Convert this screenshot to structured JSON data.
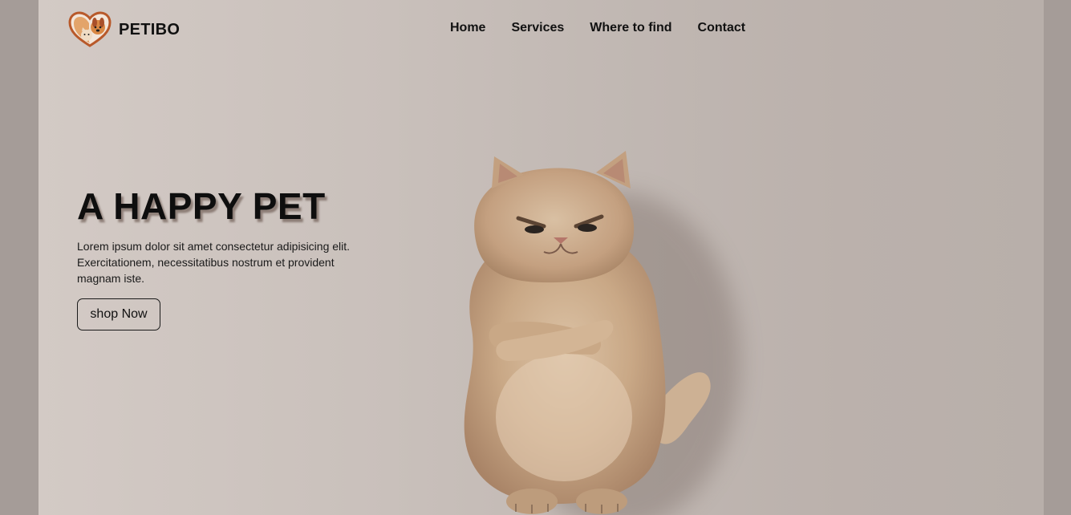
{
  "brand": {
    "name": "PETIBO",
    "logo_icon": "heart-dog-cat-icon"
  },
  "nav": {
    "items": [
      {
        "label": "Home"
      },
      {
        "label": "Services"
      },
      {
        "label": "Where to find"
      },
      {
        "label": "Contact"
      }
    ]
  },
  "hero": {
    "title": "A HAPPY PET",
    "description": "Lorem ipsum dolor sit amet consectetur adipisicing elit. Exercitationem, necessitatibus nostrum et provident magnam iste.",
    "cta_label": "shop Now",
    "image": "grumpy-fluffy-cat-arms-crossed"
  },
  "colors": {
    "background": "#c9c0bb",
    "text": "#111111",
    "accent": "#c8682c"
  }
}
